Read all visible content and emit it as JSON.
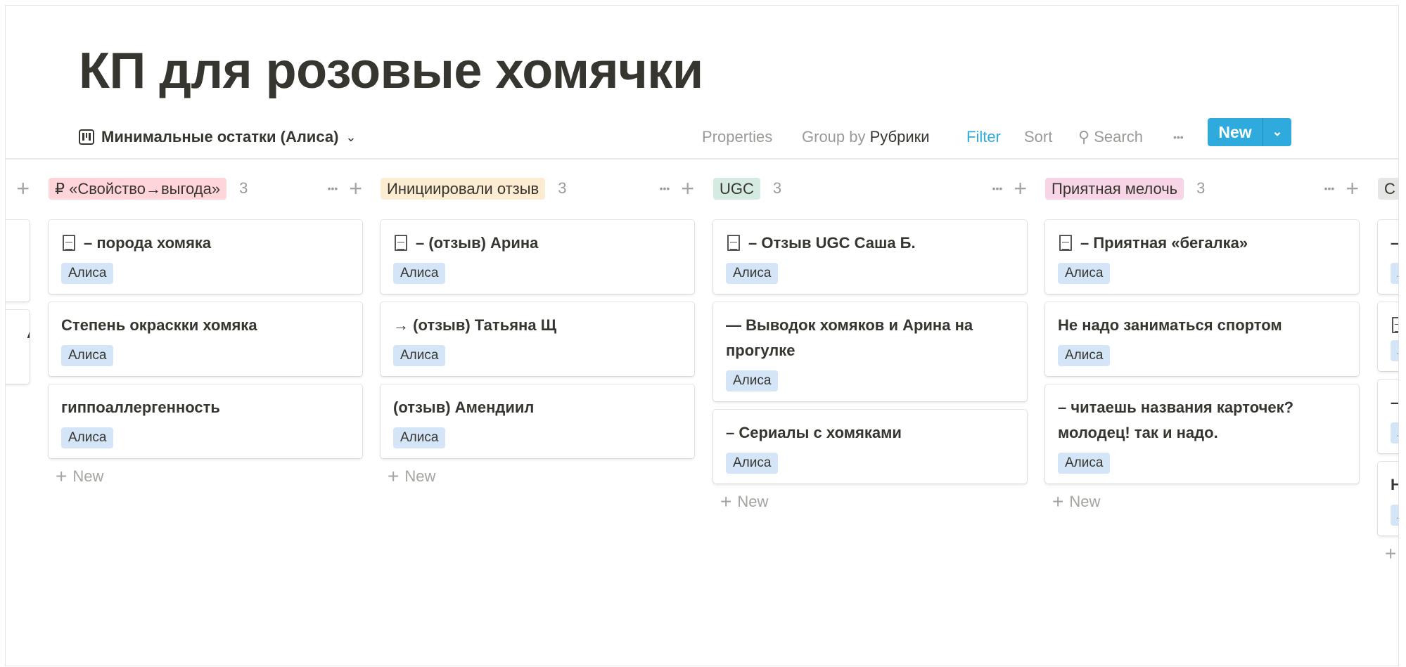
{
  "title": "КП для розовые хомячки",
  "toolbar": {
    "view_name": "Минимальные остатки (Алиса)",
    "properties": "Properties",
    "group_by_label": "Group by",
    "group_by_value": "Рубрики",
    "filter": "Filter",
    "sort": "Sort",
    "search": "Search",
    "more": "•••",
    "new": "New",
    "new_caret": "⌄"
  },
  "colors": {
    "accent": "#2eaadc",
    "person_tag": "#d3e5f7"
  },
  "add_new_label": "New",
  "columns": [
    {
      "name": "",
      "color": "",
      "count": "",
      "cards": [
        {
          "title": "",
          "icon": ""
        },
        {
          "title": "А",
          "icon": ""
        }
      ]
    },
    {
      "name": "₽ «Свойство→выгода»",
      "color": "#ffd5d9",
      "count": "3",
      "cards": [
        {
          "title": "– порода хомяка",
          "icon": "document-icon",
          "person": "Алиса"
        },
        {
          "title": "Степень окраскки хомяка",
          "icon": "",
          "person": "Алиса"
        },
        {
          "title": "гиппоаллергенность",
          "icon": "",
          "person": "Алиса"
        }
      ]
    },
    {
      "name": "Инициировали отзыв",
      "color": "#fbecd2",
      "count": "3",
      "cards": [
        {
          "title": "– (отзыв) Арина",
          "icon": "document-icon",
          "person": "Алиса"
        },
        {
          "title": "→ (отзыв) Татьяна Щ",
          "icon": "",
          "person": "Алиса"
        },
        {
          "title": "(отзыв) Амендиил",
          "icon": "",
          "person": "Алиса"
        }
      ]
    },
    {
      "name": "UGC",
      "color": "#d5ebe1",
      "count": "3",
      "cards": [
        {
          "title": "– Отзыв UGC Саша Б.",
          "icon": "document-icon",
          "person": "Алиса"
        },
        {
          "title": "—  Выводок хомяков и Арина на прогулке",
          "icon": "",
          "person": "Алиса"
        },
        {
          "title": "– Сериалы с хомяками",
          "icon": "",
          "person": "Алиса"
        }
      ]
    },
    {
      "name": "Приятная мелочь",
      "color": "#f7d5e6",
      "count": "3",
      "cards": [
        {
          "title": "– Приятная «бегалка»",
          "icon": "document-icon",
          "person": "Алиса"
        },
        {
          "title": "Не надо заниматься спортом",
          "icon": "",
          "person": "Алиса"
        },
        {
          "title": "– читаешь названия карточек? молодец! так и надо.",
          "icon": "",
          "person": "Алиса"
        }
      ]
    },
    {
      "name": "С",
      "color": "#e6e6e4",
      "count": "",
      "cards": [
        {
          "title": "–",
          "icon": "",
          "person": "А"
        },
        {
          "title": "",
          "icon": "document-icon",
          "person": "А"
        },
        {
          "title": "–",
          "icon": "",
          "person": "А"
        },
        {
          "title": "Н",
          "icon": "",
          "person": "А"
        }
      ]
    }
  ]
}
